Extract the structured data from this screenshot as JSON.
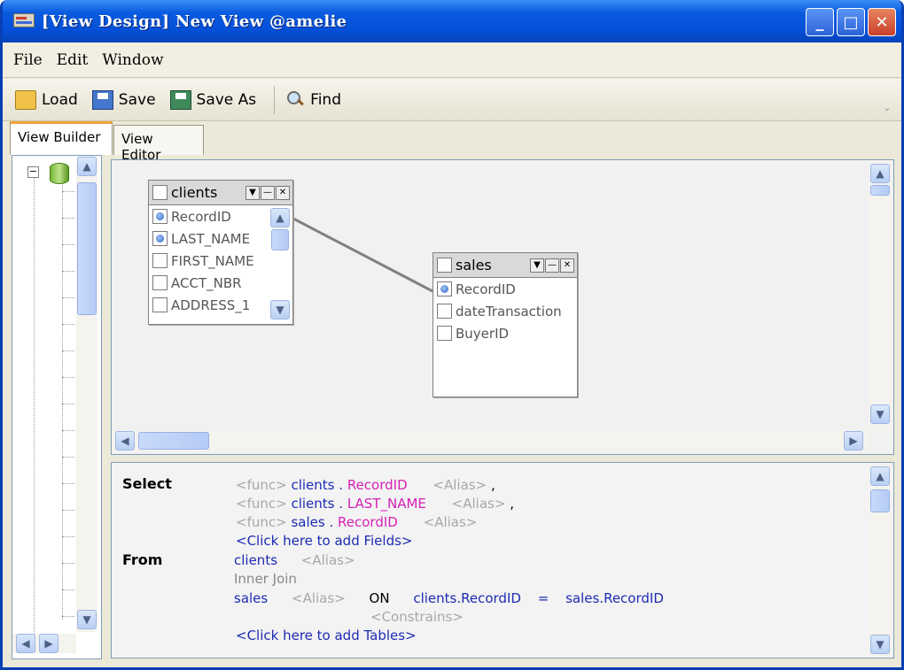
{
  "window": {
    "title": "[View Design] New View @amelie"
  },
  "menu": {
    "file": "File",
    "edit": "Edit",
    "window": "Window"
  },
  "toolbar": {
    "load": "Load",
    "save": "Save",
    "save_as": "Save As",
    "find": "Find"
  },
  "tabs": {
    "builder": "View Builder",
    "editor": "View Editor"
  },
  "tables": [
    {
      "name": "clients",
      "fields": [
        {
          "label": "RecordID",
          "checked": true
        },
        {
          "label": "LAST_NAME",
          "checked": true
        },
        {
          "label": "FIRST_NAME",
          "checked": false
        },
        {
          "label": "ACCT_NBR",
          "checked": false
        },
        {
          "label": "ADDRESS_1",
          "checked": false
        }
      ]
    },
    {
      "name": "sales",
      "fields": [
        {
          "label": "RecordID",
          "checked": true
        },
        {
          "label": "dateTransaction",
          "checked": false
        },
        {
          "label": "BuyerID",
          "checked": false
        }
      ]
    }
  ],
  "sql": {
    "select_kw": "Select",
    "from_kw": "From",
    "func": "<func>",
    "alias": "<Alias>",
    "dot": ".",
    "comma": ",",
    "f1_table": "clients",
    "f1_field": "RecordID",
    "f2_table": "clients",
    "f2_field": "LAST_NAME",
    "f3_table": "sales",
    "f3_field": "RecordID",
    "add_fields": "<Click here to add Fields>",
    "from_table": "clients",
    "join_type": "Inner Join",
    "join_table": "sales",
    "on_kw": "ON",
    "on_left": "clients.RecordID",
    "eq": "=",
    "on_right": "sales.RecordID",
    "constrains": "<Constrains>",
    "add_tables": "<Click here to add Tables>"
  }
}
